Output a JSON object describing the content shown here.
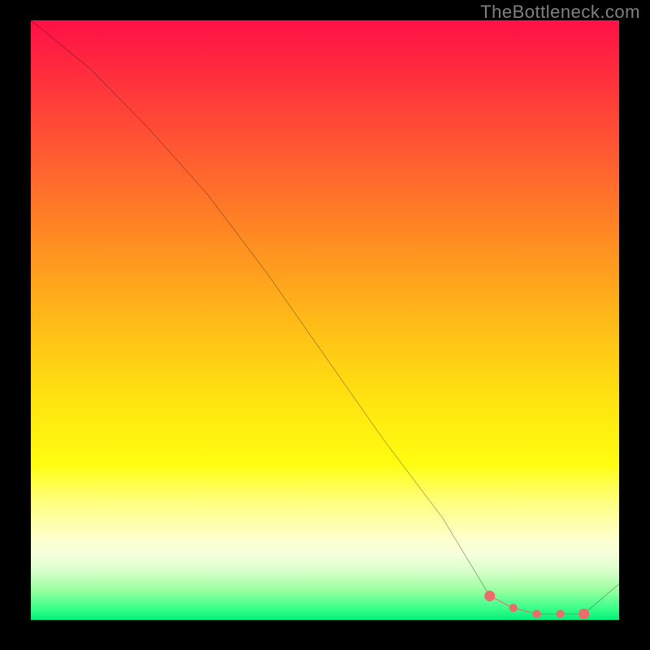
{
  "watermark": "TheBottleneck.com",
  "chart_data": {
    "type": "line",
    "title": "",
    "xlabel": "",
    "ylabel": "",
    "xlim": [
      0,
      100
    ],
    "ylim": [
      0,
      100
    ],
    "grid": false,
    "series": [
      {
        "name": "curve",
        "x": [
          0,
          10,
          20,
          30,
          40,
          50,
          60,
          70,
          78,
          82,
          86,
          90,
          94,
          100
        ],
        "y": [
          100,
          92,
          82,
          71,
          58,
          44,
          30,
          17,
          4,
          2,
          1,
          1,
          1,
          6
        ],
        "color": "#000000"
      }
    ],
    "markers": {
      "name": "highlight-range",
      "color": "#ef6a6a",
      "x": [
        78,
        82,
        86,
        90,
        94
      ],
      "y": [
        4,
        2,
        1,
        1,
        1
      ]
    },
    "background_gradient_top": "#ff1047",
    "background_gradient_bottom": "#00f07a"
  }
}
